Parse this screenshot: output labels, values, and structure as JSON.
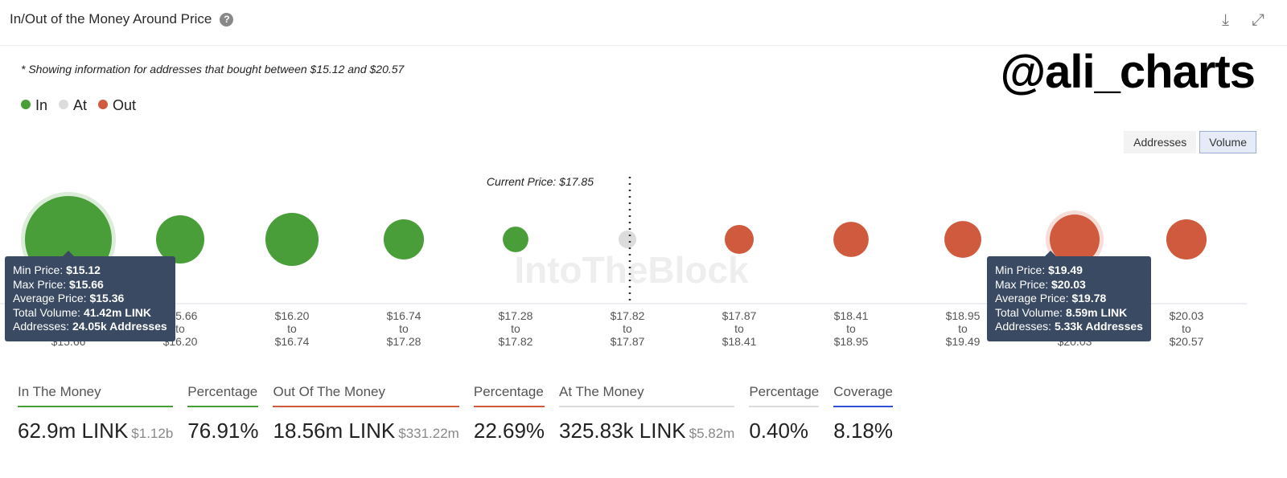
{
  "header": {
    "title": "In/Out of the Money Around Price",
    "help_icon": "question-circle-icon",
    "download_icon": "download-icon",
    "expand_icon": "expand-icon"
  },
  "note": "* Showing information for addresses that bought between $15.12 and $20.57",
  "watermark_handle": "@ali_charts",
  "logo_watermark": "IntoTheBlock",
  "toggle": {
    "addresses": "Addresses",
    "volume": "Volume",
    "active": "Volume"
  },
  "colors": {
    "in": "#4a9e3a",
    "at": "#dcdcdc",
    "out": "#cf5a3e",
    "coverage": "#2f4fd6"
  },
  "chart_data": {
    "type": "bubble",
    "legend": [
      {
        "name": "In",
        "color": "#4a9e3a"
      },
      {
        "name": "At",
        "color": "#dcdcdc"
      },
      {
        "name": "Out",
        "color": "#cf5a3e"
      }
    ],
    "legend_placement": "top-left",
    "current_price_label": "Current Price: $17.85",
    "current_price": 17.85,
    "bins": [
      {
        "from": "$15.12",
        "to": "$15.66",
        "status": "in",
        "volume_m": 41.42
      },
      {
        "from": "$15.66",
        "to": "$16.20",
        "status": "in",
        "volume_m": 12.8
      },
      {
        "from": "$16.20",
        "to": "$16.74",
        "status": "in",
        "volume_m": 15.5
      },
      {
        "from": "$16.74",
        "to": "$17.28",
        "status": "in",
        "volume_m": 8.9
      },
      {
        "from": "$17.28",
        "to": "$17.82",
        "status": "in",
        "volume_m": 3.6
      },
      {
        "from": "$17.82",
        "to": "$17.87",
        "status": "at",
        "volume_m": 0.33
      },
      {
        "from": "$17.87",
        "to": "$18.41",
        "status": "out",
        "volume_m": 2.9
      },
      {
        "from": "$18.41",
        "to": "$18.95",
        "status": "out",
        "volume_m": 4.3
      },
      {
        "from": "$18.95",
        "to": "$19.49",
        "status": "out",
        "volume_m": 4.7
      },
      {
        "from": "$19.49",
        "to": "$20.03",
        "status": "out",
        "volume_m": 8.59
      },
      {
        "from": "$20.03",
        "to": "$20.57",
        "status": "out",
        "volume_m": 5.6
      }
    ],
    "to_word": "to",
    "tooltips": [
      {
        "bin": 0,
        "rows": [
          [
            "Min Price: ",
            "$15.12"
          ],
          [
            "Max Price: ",
            "$15.66"
          ],
          [
            "Average Price: ",
            "$15.36"
          ],
          [
            "Total Volume: ",
            "41.42m LINK"
          ],
          [
            "Addresses: ",
            "24.05k Addresses"
          ]
        ]
      },
      {
        "bin": 9,
        "rows": [
          [
            "Min Price: ",
            "$19.49"
          ],
          [
            "Max Price: ",
            "$20.03"
          ],
          [
            "Average Price: ",
            "$19.78"
          ],
          [
            "Total Volume: ",
            "8.59m LINK"
          ],
          [
            "Addresses: ",
            "5.33k Addresses"
          ]
        ]
      }
    ]
  },
  "stats": [
    {
      "label": "In The Money",
      "value": "62.9m LINK",
      "sub": "$1.12b",
      "color": "#4a9e3a"
    },
    {
      "label": "Percentage",
      "value": "76.91%",
      "sub": "",
      "color": "#4a9e3a"
    },
    {
      "label": "Out Of The Money",
      "value": "18.56m LINK",
      "sub": "$331.22m",
      "color": "#cf5a3e"
    },
    {
      "label": "Percentage",
      "value": "22.69%",
      "sub": "",
      "color": "#cf5a3e"
    },
    {
      "label": "At The Money",
      "value": "325.83k LINK",
      "sub": "$5.82m",
      "color": "#dcdcdc"
    },
    {
      "label": "Percentage",
      "value": "0.40%",
      "sub": "",
      "color": "#dcdcdc"
    },
    {
      "label": "Coverage",
      "value": "8.18%",
      "sub": "",
      "color": "#2f4fd6"
    }
  ]
}
